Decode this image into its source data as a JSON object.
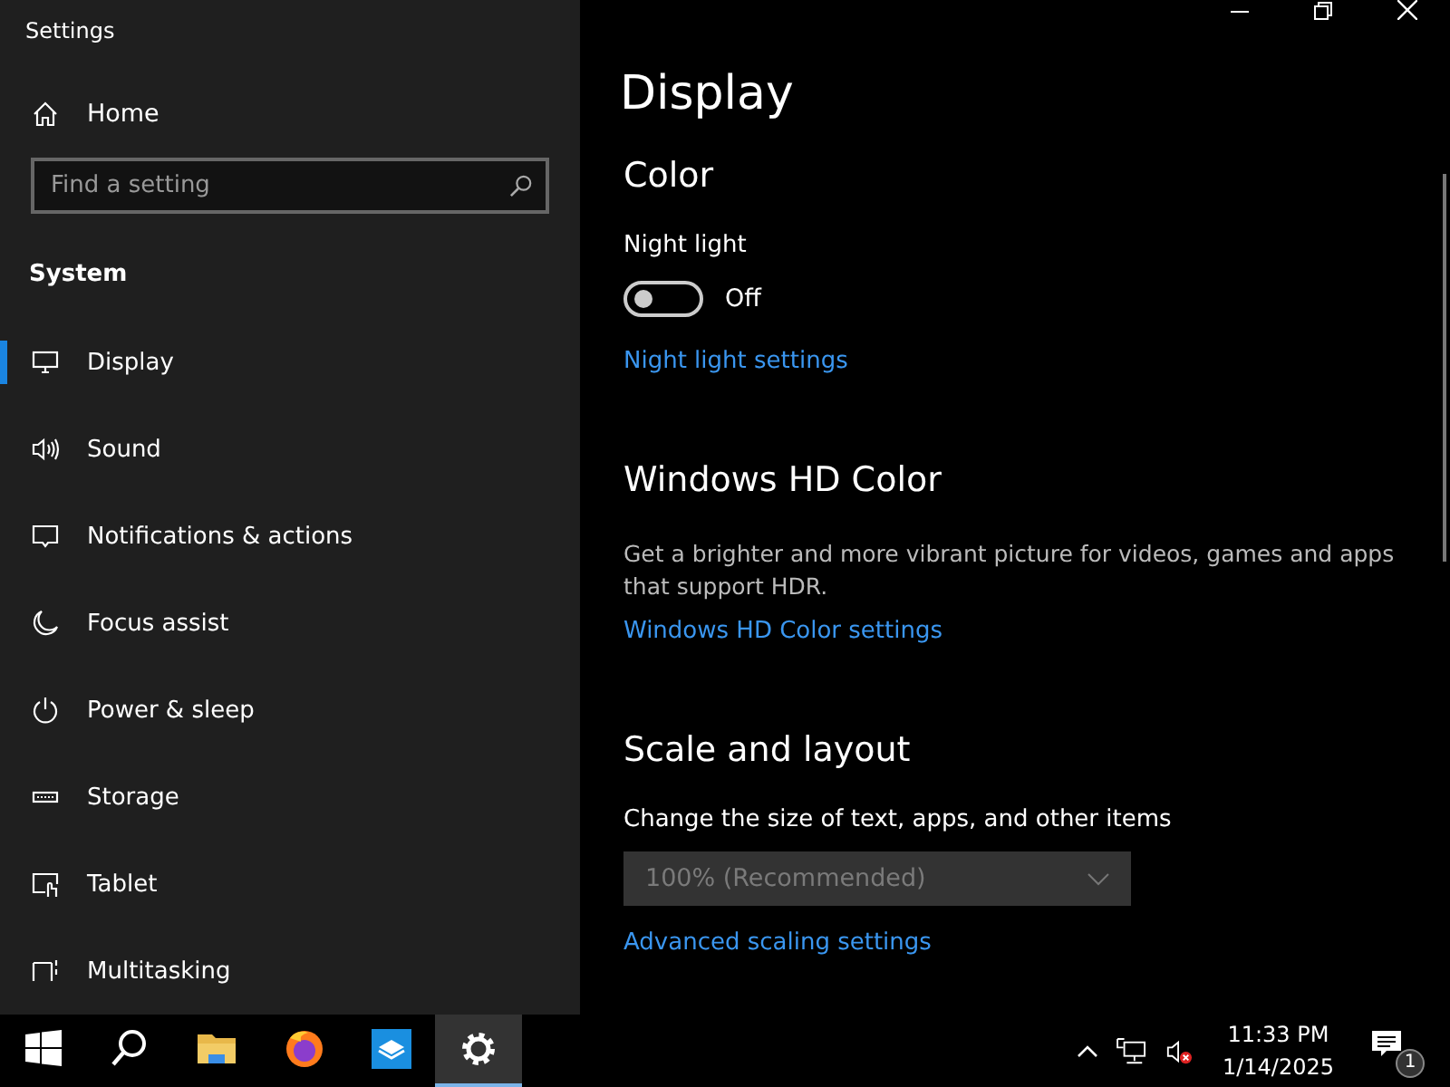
{
  "window": {
    "title": "Settings"
  },
  "sidebar": {
    "home": "Home",
    "search": {
      "placeholder": "Find a setting"
    },
    "section": "System",
    "items": [
      {
        "label": "Display",
        "kind": "display",
        "selected": true
      },
      {
        "label": "Sound",
        "kind": "sound",
        "selected": false
      },
      {
        "label": "Notifications & actions",
        "kind": "notifications",
        "selected": false
      },
      {
        "label": "Focus assist",
        "kind": "focus",
        "selected": false
      },
      {
        "label": "Power & sleep",
        "kind": "power",
        "selected": false
      },
      {
        "label": "Storage",
        "kind": "storage",
        "selected": false
      },
      {
        "label": "Tablet",
        "kind": "tablet",
        "selected": false
      },
      {
        "label": "Multitasking",
        "kind": "multitasking",
        "selected": false
      }
    ]
  },
  "page": {
    "title": "Display",
    "sections": [
      {
        "heading": "Color",
        "setting": "Night light",
        "toggle": {
          "on": false,
          "state": "Off"
        },
        "link": "Night light settings"
      },
      {
        "heading": "Windows HD Color",
        "description": "Get a brighter and more vibrant picture for videos, games and apps that support HDR.",
        "link": "Windows HD Color settings"
      },
      {
        "heading": "Scale and layout",
        "setting": "Change the size of text, apps, and other items",
        "dropdown": {
          "value": "100% (Recommended)",
          "disabled": true
        },
        "link": "Advanced scaling settings"
      }
    ]
  },
  "taskbar": {
    "apps": [
      {
        "kind": "start",
        "selected": false
      },
      {
        "kind": "search",
        "selected": false
      },
      {
        "kind": "explorer",
        "selected": false
      },
      {
        "kind": "firefox",
        "selected": false
      },
      {
        "kind": "app",
        "selected": false
      },
      {
        "kind": "settings",
        "selected": true
      }
    ],
    "time": "11:33 PM",
    "date": "1/14/2025",
    "notifications": "1"
  }
}
